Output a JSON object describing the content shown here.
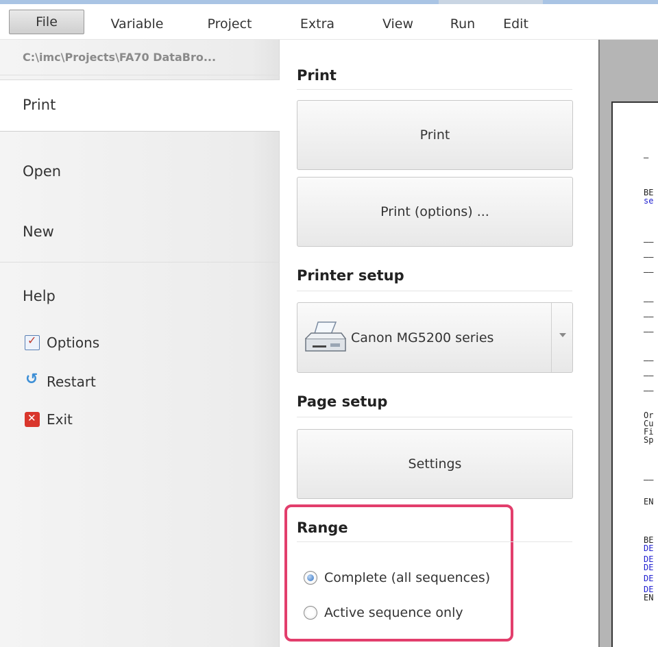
{
  "menubar": {
    "items": [
      "File",
      "Variable",
      "Project",
      "Extra",
      "View",
      "Run",
      "Edit"
    ]
  },
  "left": {
    "path": "C:\\imc\\Projects\\FA70 DataBro...",
    "print": "Print",
    "open": "Open",
    "new": "New",
    "help": "Help",
    "options": "Options",
    "restart": "Restart",
    "exit": "Exit"
  },
  "main": {
    "print_section": "Print",
    "print_button": "Print",
    "print_options_button": "Print (options) ...",
    "printer_setup_section": "Printer setup",
    "printer_name": "Canon MG5200 series",
    "page_setup_section": "Page setup",
    "settings_button": "Settings",
    "range_section": "Range",
    "range_options": [
      {
        "label": "Complete (all sequences)",
        "checked": true
      },
      {
        "label": "Active sequence only",
        "checked": false
      }
    ],
    "highlight_color": "#e23e6c"
  },
  "preview": {
    "lines": [
      {
        "text": "—",
        "color": "black"
      },
      {
        "text": "BE",
        "color": "black"
      },
      {
        "text": "se",
        "color": "blue"
      },
      {
        "text": "——",
        "color": "black"
      },
      {
        "text": "——",
        "color": "black"
      },
      {
        "text": "——",
        "color": "black"
      },
      {
        "text": "——",
        "color": "black"
      },
      {
        "text": "——",
        "color": "black"
      },
      {
        "text": "——",
        "color": "black"
      },
      {
        "text": "——",
        "color": "black"
      },
      {
        "text": "——",
        "color": "black"
      },
      {
        "text": "——",
        "color": "black"
      },
      {
        "text": "Or",
        "color": "black"
      },
      {
        "text": "Cu",
        "color": "black"
      },
      {
        "text": "Fi",
        "color": "black"
      },
      {
        "text": "Sp",
        "color": "black"
      },
      {
        "text": "——",
        "color": "black"
      },
      {
        "text": "EN",
        "color": "black"
      },
      {
        "text": "BE",
        "color": "black"
      },
      {
        "text": "DE",
        "color": "blue"
      },
      {
        "text": "DE",
        "color": "blue"
      },
      {
        "text": "DE",
        "color": "blue"
      },
      {
        "text": "DE",
        "color": "blue"
      },
      {
        "text": "DE",
        "color": "blue"
      },
      {
        "text": "EN",
        "color": "black"
      }
    ]
  }
}
